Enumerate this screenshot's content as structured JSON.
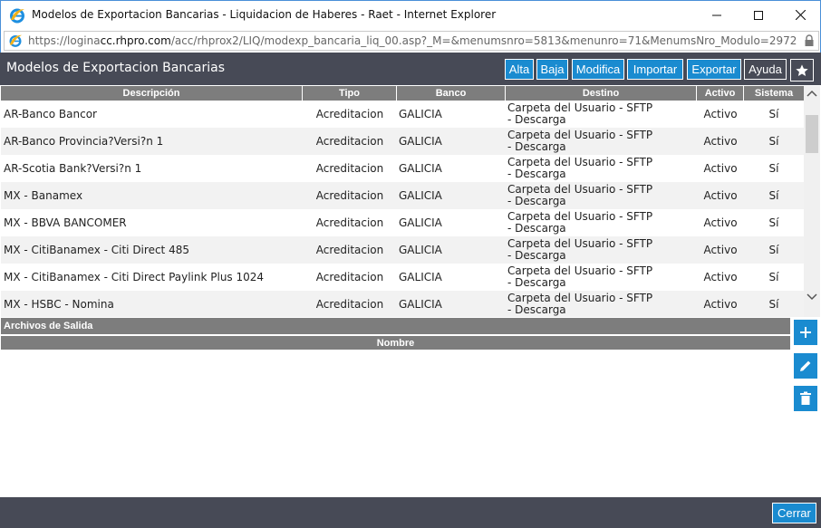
{
  "window": {
    "title": "Modelos de Exportacion Bancarias - Liquidacion de Haberes - Raet - Internet Explorer"
  },
  "address": {
    "url_prefix": "https://logina",
    "url_domain": "cc.rhpro.com",
    "url_path": "/acc/rhprox2/LIQ/modexp_bancaria_liq_00.asp?_M=&menumsnro=5813&menunro=71&MenumsNro_Modulo=2972"
  },
  "header": {
    "title": "Modelos de Exportacion Bancarias",
    "buttons": {
      "alta": "Alta",
      "baja": "Baja",
      "modifica": "Modifica",
      "importar": "Importar",
      "exportar": "Exportar",
      "ayuda": "Ayuda"
    }
  },
  "grid": {
    "columns": [
      "Descripción",
      "Tipo",
      "Banco",
      "Destino",
      "Activo",
      "Sistema"
    ],
    "rows": [
      {
        "descripcion": "AR-Banco Bancor",
        "tipo": "Acreditacion",
        "banco": "GALICIA",
        "destino": "Carpeta del Usuario - SFTP - Descarga",
        "activo": "Activo",
        "sistema": "Sí"
      },
      {
        "descripcion": "AR-Banco Provincia?Versi?n 1",
        "tipo": "Acreditacion",
        "banco": "GALICIA",
        "destino": "Carpeta del Usuario - SFTP - Descarga",
        "activo": "Activo",
        "sistema": "Sí"
      },
      {
        "descripcion": "AR-Scotia Bank?Versi?n 1",
        "tipo": "Acreditacion",
        "banco": "GALICIA",
        "destino": "Carpeta del Usuario - SFTP - Descarga",
        "activo": "Activo",
        "sistema": "Sí"
      },
      {
        "descripcion": "MX - Banamex",
        "tipo": "Acreditacion",
        "banco": "GALICIA",
        "destino": "Carpeta del Usuario - SFTP - Descarga",
        "activo": "Activo",
        "sistema": "Sí"
      },
      {
        "descripcion": "MX - BBVA BANCOMER",
        "tipo": "Acreditacion",
        "banco": "GALICIA",
        "destino": "Carpeta del Usuario - SFTP - Descarga",
        "activo": "Activo",
        "sistema": "Sí"
      },
      {
        "descripcion": "MX - CitiBanamex - Citi Direct 485",
        "tipo": "Acreditacion",
        "banco": "GALICIA",
        "destino": "Carpeta del Usuario - SFTP - Descarga",
        "activo": "Activo",
        "sistema": "Sí"
      },
      {
        "descripcion": "MX - CitiBanamex - Citi Direct Paylink Plus 1024",
        "tipo": "Acreditacion",
        "banco": "GALICIA",
        "destino": "Carpeta del Usuario - SFTP - Descarga",
        "activo": "Activo",
        "sistema": "Sí"
      },
      {
        "descripcion": "MX - HSBC - Nomina",
        "tipo": "Acreditacion",
        "banco": "GALICIA",
        "destino": "Carpeta del Usuario - SFTP - Descarga",
        "activo": "Activo",
        "sistema": "Sí"
      }
    ]
  },
  "archivos": {
    "title": "Archivos de Salida",
    "column": "Nombre"
  },
  "footer": {
    "close_label": "Cerrar"
  },
  "colors": {
    "accent": "#1a8bd0",
    "header_bg": "#474a56",
    "grid_header_bg": "#7d7d7d"
  },
  "icons": [
    "ie-icon",
    "minimize-icon",
    "maximize-icon",
    "close-icon",
    "lock-icon",
    "star-icon",
    "plus-icon",
    "pencil-icon",
    "trash-icon",
    "scroll-up-icon",
    "scroll-down-icon"
  ]
}
